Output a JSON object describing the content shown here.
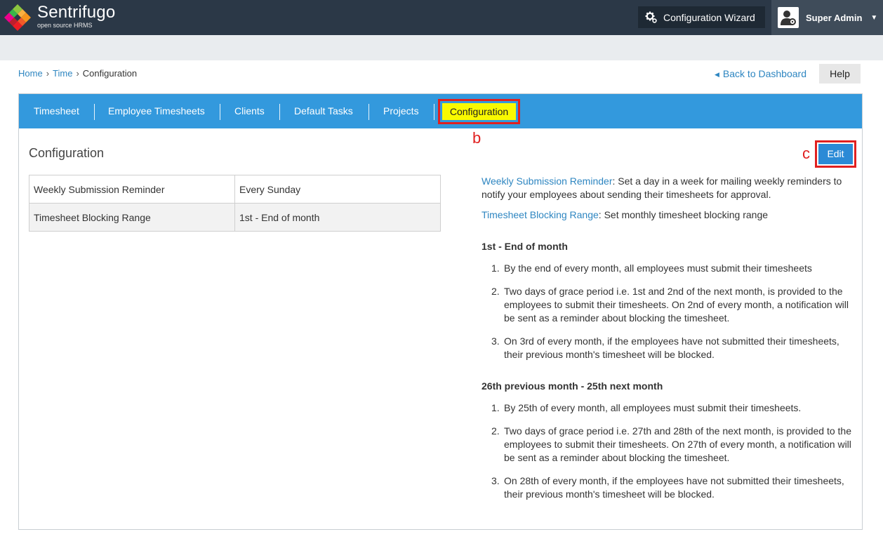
{
  "header": {
    "brand_name": "Sentrifugo",
    "brand_sub": "open source HRMS",
    "wizard_label": "Configuration Wizard",
    "user_name": "Super Admin"
  },
  "breadcrumb": {
    "home": "Home",
    "time": "Time",
    "current": "Configuration",
    "sep": "›"
  },
  "nav": {
    "back_label": "Back to Dashboard",
    "help_label": "Help"
  },
  "tabs": [
    {
      "label": "Timesheet"
    },
    {
      "label": "Employee Timesheets"
    },
    {
      "label": "Clients"
    },
    {
      "label": "Default Tasks"
    },
    {
      "label": "Projects"
    },
    {
      "label": "Configuration"
    }
  ],
  "annotations": {
    "b": "b",
    "c": "c"
  },
  "section": {
    "title": "Configuration",
    "edit_label": "Edit"
  },
  "settings": [
    {
      "key": "Weekly Submission Reminder",
      "value": "Every Sunday"
    },
    {
      "key": "Timesheet Blocking Range",
      "value": "1st - End of month"
    }
  ],
  "help_text": {
    "weekly_key": "Weekly Submission Reminder",
    "weekly_desc": ": Set a day in a week for mailing weekly reminders to notify your employees about sending their timesheets for approval.",
    "blocking_key": "Timesheet Blocking Range",
    "blocking_desc": ": Set monthly timesheet blocking range",
    "groups": [
      {
        "title": "1st - End of month",
        "items": [
          {
            "num": "1.",
            "text": "By the end of every month, all employees must submit their timesheets"
          },
          {
            "num": "2.",
            "text": "Two days of grace period i.e. 1st and 2nd of the next month, is provided to the employees to submit their timesheets. On 2nd of every month, a notification will be sent as a reminder about blocking the timesheet."
          },
          {
            "num": "3.",
            "text": "On 3rd of every month, if the employees have not submitted their timesheets, their previous month's timesheet will be blocked."
          }
        ]
      },
      {
        "title": "26th previous month - 25th next month",
        "items": [
          {
            "num": "1.",
            "text": "By 25th of every month, all employees must submit their timesheets."
          },
          {
            "num": "2.",
            "text": "Two days of grace period i.e. 27th and 28th of the next month, is provided to the employees to submit their timesheets. On 27th of every month, a notification will be sent as a reminder about blocking the timesheet."
          },
          {
            "num": "3.",
            "text": "On 28th of every month, if the employees have not submitted their timesheets, their previous month's timesheet will be blocked."
          }
        ]
      }
    ]
  },
  "colors": {
    "header_bg": "#2b3847",
    "tab_bar": "#3399dd",
    "active_tab_highlight": "#f9f900",
    "annotation_red": "#e02020",
    "link_blue": "#2e86c1"
  }
}
